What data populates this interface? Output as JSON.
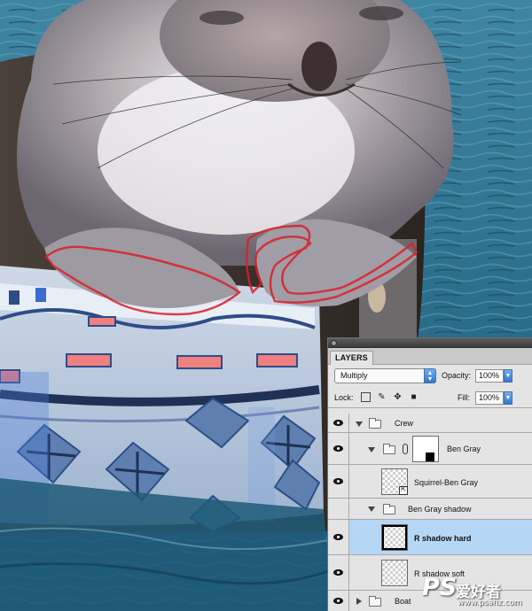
{
  "panel": {
    "tab_label": "LAYERS",
    "blend_mode": "Multiply",
    "opacity_label": "Opacity:",
    "opacity_value": "100%",
    "lock_label": "Lock:",
    "fill_label": "Fill:",
    "fill_value": "100%",
    "lock_icons": [
      "lock-transparent-icon",
      "lock-brush-icon",
      "lock-move-icon",
      "lock-all-icon"
    ]
  },
  "layers": [
    {
      "name": "Crew",
      "type": "group",
      "expanded": true,
      "visible": true
    },
    {
      "name": "Ben Gray",
      "type": "group-with-mask",
      "expanded": true,
      "visible": true
    },
    {
      "name": "Squirrel-Ben Gray",
      "type": "smart-object",
      "visible": true
    },
    {
      "name": "Ben Gray shadow",
      "type": "group",
      "expanded": true,
      "visible": false
    },
    {
      "name": "R shadow hard",
      "type": "layer",
      "visible": true,
      "selected": true
    },
    {
      "name": "R shadow soft",
      "type": "layer",
      "visible": true
    },
    {
      "name": "Boat",
      "type": "group",
      "expanded": false,
      "visible": true
    }
  ],
  "watermark": {
    "logo": "PS",
    "chinese": "爱好者",
    "url": "www.psahz.com"
  },
  "colors": {
    "water": "#2a6a86",
    "selected_row": "#b6d6f6",
    "panel_bg": "#e4e4e4",
    "selection_path": "#d8202a"
  }
}
